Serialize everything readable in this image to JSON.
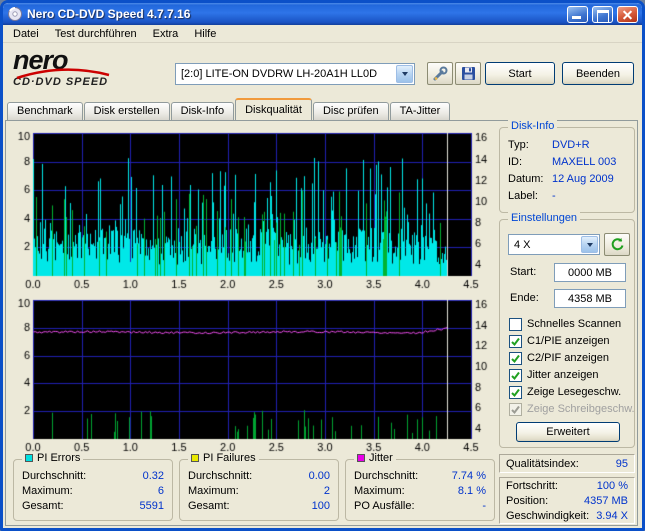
{
  "window": {
    "title": "Nero CD-DVD Speed 4.7.7.16"
  },
  "menu": {
    "items": [
      "Datei",
      "Test durchführen",
      "Extra",
      "Hilfe"
    ]
  },
  "logo": {
    "brand": "nero",
    "product": "CD·DVD SPEED"
  },
  "header": {
    "drive_select": "[2:0]  LITE-ON DVDRW LH-20A1H LL0D",
    "start_label": "Start",
    "exit_label": "Beenden"
  },
  "tabs": [
    {
      "label": "Benchmark",
      "active": false
    },
    {
      "label": "Disk erstellen",
      "active": false
    },
    {
      "label": "Disk-Info",
      "active": false
    },
    {
      "label": "Diskqualität",
      "active": true
    },
    {
      "label": "Disc prüfen",
      "active": false
    },
    {
      "label": "TA-Jitter",
      "active": false
    }
  ],
  "disk_info": {
    "title": "Disk-Info",
    "rows": [
      {
        "label": "Typ:",
        "value": "DVD+R"
      },
      {
        "label": "ID:",
        "value": "MAXELL 003"
      },
      {
        "label": "Datum:",
        "value": "12 Aug 2009"
      },
      {
        "label": "Label:",
        "value": "-"
      }
    ]
  },
  "settings": {
    "title": "Einstellungen",
    "speed_value": "4 X",
    "start_label": "Start:",
    "start_value": "0000 MB",
    "end_label": "Ende:",
    "end_value": "4358 MB",
    "checkboxes": [
      {
        "label": "Schnelles Scannen",
        "checked": false,
        "disabled": false
      },
      {
        "label": "C1/PIE anzeigen",
        "checked": true,
        "disabled": false
      },
      {
        "label": "C2/PIF anzeigen",
        "checked": true,
        "disabled": false
      },
      {
        "label": "Jitter anzeigen",
        "checked": true,
        "disabled": false
      },
      {
        "label": "Zeige Lesegeschw.",
        "checked": true,
        "disabled": false
      },
      {
        "label": "Zeige Schreibgeschw.",
        "checked": true,
        "disabled": true
      }
    ],
    "advanced_label": "Erweitert"
  },
  "quality": {
    "label": "Qualitätsindex:",
    "value": "95"
  },
  "progress": {
    "rows": [
      {
        "label": "Fortschritt:",
        "value": "100 %"
      },
      {
        "label": "Position:",
        "value": "4357 MB"
      },
      {
        "label": "Geschwindigkeit:",
        "value": "3.94 X"
      }
    ]
  },
  "stats": [
    {
      "title": "PI Errors",
      "color": "#00E0E0",
      "rows": [
        {
          "label": "Durchschnitt:",
          "value": "0.32"
        },
        {
          "label": "Maximum:",
          "value": "6"
        },
        {
          "label": "Gesamt:",
          "value": "5591"
        }
      ]
    },
    {
      "title": "PI Failures",
      "color": "#E8E800",
      "rows": [
        {
          "label": "Durchschnitt:",
          "value": "0.00"
        },
        {
          "label": "Maximum:",
          "value": "2"
        },
        {
          "label": "Gesamt:",
          "value": "100"
        }
      ]
    },
    {
      "title": "Jitter",
      "color": "#E800E8",
      "rows": [
        {
          "label": "Durchschnitt:",
          "value": "7.74 %"
        },
        {
          "label": "Maximum:",
          "value": "8.1 %"
        },
        {
          "label": "PO Ausfälle:",
          "value": "-"
        }
      ]
    }
  ],
  "chart_data": [
    {
      "name": "PI Errors scan",
      "type": "bar",
      "x_range": [
        0,
        4.5
      ],
      "x_tick_labels": [
        "0.0",
        "0.5",
        "1.0",
        "1.5",
        "2.0",
        "2.5",
        "3.0",
        "3.5",
        "4.0",
        "4.5"
      ],
      "y_left": {
        "range": [
          0,
          10
        ],
        "ticks": [
          2,
          4,
          6,
          8,
          10
        ]
      },
      "y_right": {
        "range": [
          3,
          16.5
        ],
        "ticks": [
          4,
          6,
          8,
          10,
          12,
          14,
          16
        ]
      },
      "grid_color": "#2121B4",
      "data_end_x": 4.25,
      "cursor": {
        "x": 4.25,
        "color": "#E4E4DA"
      },
      "series": [
        {
          "style": "bars",
          "name": "C1/PIE",
          "color": "#00E8E8",
          "seed": 7,
          "base_min": 0.8,
          "base_max": 3.4,
          "spike_chance": 0.2,
          "spike_min": 3.0,
          "spike_max": 8.3
        },
        {
          "style": "spikes",
          "name": "C2/PIF",
          "color": "#00B432",
          "seed": 11,
          "count": 55,
          "min": 2.0,
          "max": 6.0
        }
      ],
      "summary": {
        "average": 0.32,
        "maximum": 6,
        "total": 5591
      }
    },
    {
      "name": "Jitter scan",
      "type": "line",
      "x_range": [
        0,
        4.5
      ],
      "x_tick_labels": [
        "0.0",
        "0.5",
        "1.0",
        "1.5",
        "2.0",
        "2.5",
        "3.0",
        "3.5",
        "4.0",
        "4.5"
      ],
      "y_left": {
        "range": [
          0,
          10
        ],
        "ticks": [
          2,
          4,
          6,
          8,
          10
        ]
      },
      "y_right": {
        "range": [
          3,
          16.5
        ],
        "ticks": [
          4,
          6,
          8,
          10,
          12,
          14,
          16
        ]
      },
      "grid_color": "#2121B4",
      "data_end_x": 4.25,
      "cursor": {
        "x": 4.25,
        "color": "#E4E4DA"
      },
      "series": [
        {
          "style": "spikes",
          "name": "PIF",
          "color": "#00A432",
          "seed": 9,
          "count": 40,
          "min": 0.4,
          "max": 2.1
        },
        {
          "style": "line",
          "name": "Jitter %",
          "color": "#FA50FA",
          "seed": 5,
          "base": 7.68,
          "noise": 0.07,
          "end_rise": 0.32
        }
      ],
      "summary": {
        "average_pct": 7.74,
        "maximum_pct": 8.1
      }
    }
  ]
}
